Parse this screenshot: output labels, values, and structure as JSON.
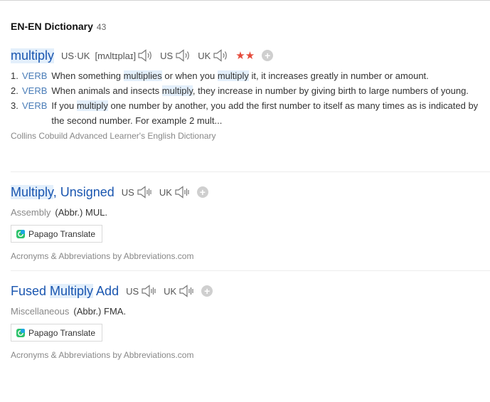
{
  "dictionary": {
    "title": "EN-EN Dictionary",
    "count": "43"
  },
  "entries": [
    {
      "headword": "multiply",
      "pron_us_uk_label": "US·UK",
      "ipa": "[mʌltɪplaɪ]",
      "us_label": "US",
      "uk_label": "UK",
      "stars": "★★",
      "definitions": [
        {
          "num": "1.",
          "pos": "VERB",
          "parts": [
            "When something ",
            "multiplies",
            " or when you ",
            "multiply",
            " it, it increases greatly in number or amount."
          ]
        },
        {
          "num": "2.",
          "pos": "VERB",
          "parts": [
            "When animals and insects ",
            "multiply",
            ", they increase in number by giving birth to large numbers of young."
          ]
        },
        {
          "num": "3.",
          "pos": "VERB",
          "parts": [
            "If you ",
            "multiply",
            " one number by another, you add the first number to itself as many times as is indicated by the second number. For example 2 mult..."
          ]
        }
      ],
      "source": "Collins Cobuild Advanced Learner's English Dictionary"
    },
    {
      "headword_parts": [
        "Multiply",
        ", Unsigned"
      ],
      "us_label": "US",
      "uk_label": "UK",
      "category": "Assembly",
      "abbr": "(Abbr.) MUL.",
      "translate_label": "Papago Translate",
      "source": "Acronyms & Abbreviations by Abbreviations.com"
    },
    {
      "headword_parts": [
        "Fused ",
        "Multiply",
        " Add"
      ],
      "us_label": "US",
      "uk_label": "UK",
      "category": "Miscellaneous",
      "abbr": "(Abbr.) FMA.",
      "translate_label": "Papago Translate",
      "source": "Acronyms & Abbreviations by Abbreviations.com"
    }
  ],
  "colors": {
    "headword": "#1a56b0",
    "highlight": "#e3effb",
    "pos": "#4a7db8",
    "star": "#e5493a"
  },
  "icons": [
    "speaker-icon",
    "add-icon",
    "papago-icon",
    "star-icon"
  ]
}
